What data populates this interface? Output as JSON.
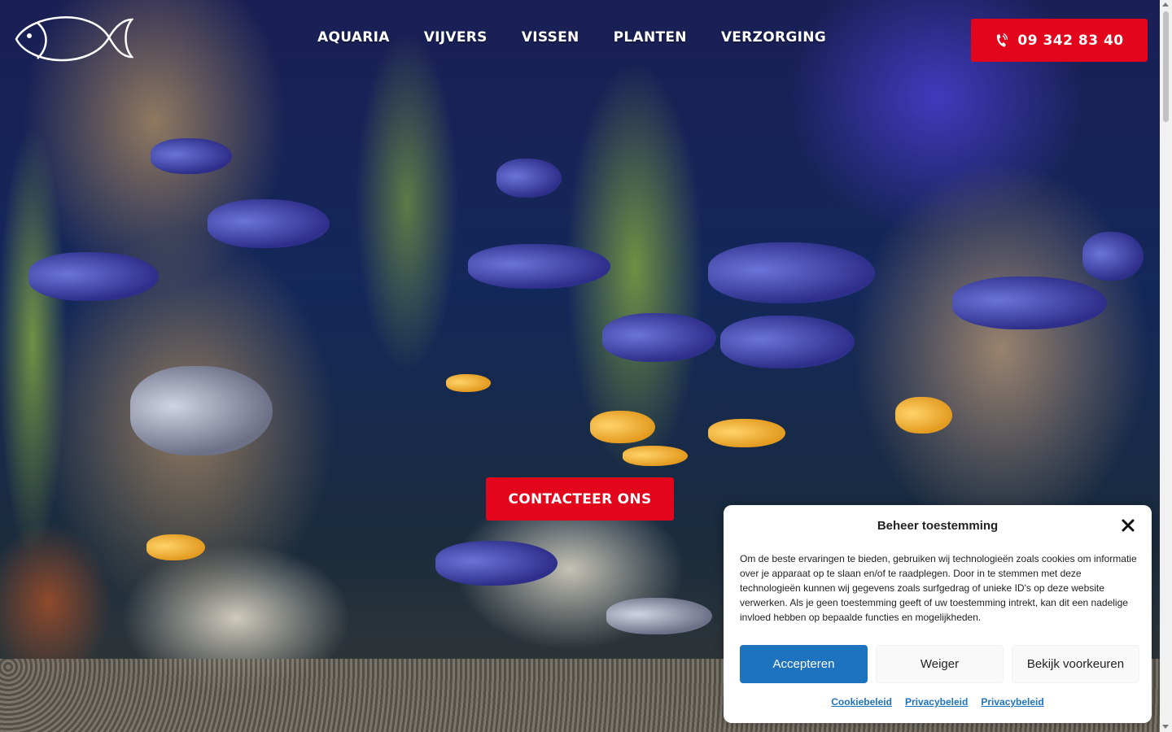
{
  "nav": {
    "items": [
      {
        "label": "AQUARIA"
      },
      {
        "label": "VIJVERS"
      },
      {
        "label": "VISSEN"
      },
      {
        "label": "PLANTEN"
      },
      {
        "label": "VERZORGING"
      }
    ]
  },
  "header": {
    "phone": "09 342 83 40",
    "phone_icon": "phone-icon",
    "logo_icon": "fish-logo-icon"
  },
  "hero": {
    "cta_label": "CONTACTEER ONS"
  },
  "cookie": {
    "title": "Beheer toestemming",
    "text": "Om de beste ervaringen te bieden, gebruiken wij technologieën zoals cookies om informatie over je apparaat op te slaan en/of te raadplegen. Door in te stemmen met deze technologieën kunnen wij gegevens zoals surfgedrag of unieke ID's op deze website verwerken. Als je geen toestemming geeft of uw toestemming intrekt, kan dit een nadelige invloed hebben op bepaalde functies en mogelijkheden.",
    "accept_label": "Accepteren",
    "deny_label": "Weiger",
    "prefs_label": "Bekijk voorkeuren",
    "links": [
      "Cookiebeleid",
      "Privacybeleid",
      "Privacybeleid"
    ]
  },
  "colors": {
    "brand_red": "#e3051b",
    "accept_blue": "#1e73be"
  }
}
